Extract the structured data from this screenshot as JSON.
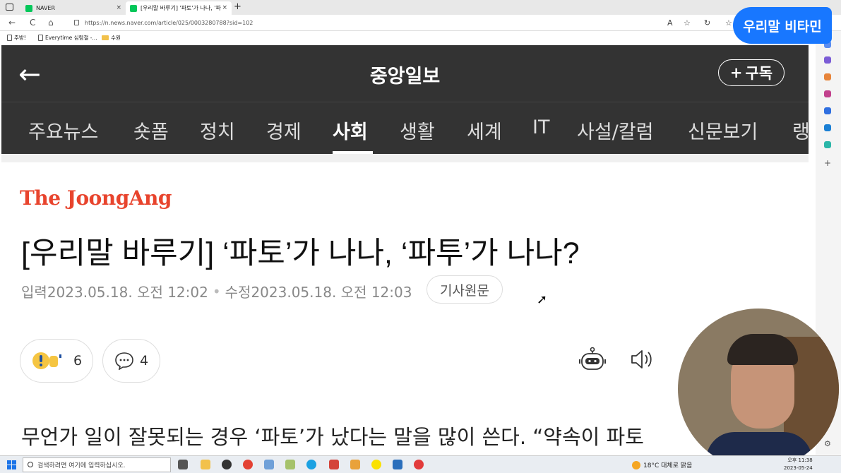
{
  "browser": {
    "tabs": [
      {
        "title": "NAVER",
        "close": "×"
      },
      {
        "title": "[우리말 바루기] '파토'가 나나, '파",
        "close": "×"
      }
    ],
    "new_tab": "+",
    "back": "←",
    "refresh": "C",
    "home": "⌂",
    "url": "https://n.news.naver.com/article/025/0003280788?sid=102",
    "bookmarks": [
      "주방!",
      "Everytime 심렴철 -...",
      "수원"
    ]
  },
  "header": {
    "back_icon": "←",
    "brand": "중앙일보",
    "subscribe_label": "구독",
    "subscribe_plus": "+"
  },
  "categories": [
    "주요뉴스",
    "숏폼",
    "정치",
    "경제",
    "사회",
    "생활",
    "세계",
    "IT",
    "사설/칼럼",
    "신문보기",
    "랭"
  ],
  "active_category": "사회",
  "article": {
    "publisher_logo": "The JoongAng",
    "headline": "[우리말 바루기] ‘파토’가 나나, ‘파투’가 나나?",
    "input_label": "입력",
    "input_date": "2023.05.18. 오전 12:02",
    "modified_label": "수정",
    "modified_date": "2023.05.18. 오전 12:03",
    "separator": "•",
    "original_button": "기사원문",
    "reaction_count": "6",
    "comment_count": "4",
    "body_start": "무언가 일이 잘못되는 경우 ‘파토’가 났다는 말을 많이 쓴다. “약속이 파토"
  },
  "overlay": {
    "banner": "우리말 비타민"
  },
  "taskbar": {
    "search_placeholder": "검색하려면 여기에 입력하십시오.",
    "weather": "18°C 대체로 맑음",
    "time": "오후 11:38",
    "date": "2023-05-24"
  },
  "colors": {
    "header_bg": "#333333",
    "logo_red": "#e8442d",
    "banner_blue": "#1877ff"
  }
}
